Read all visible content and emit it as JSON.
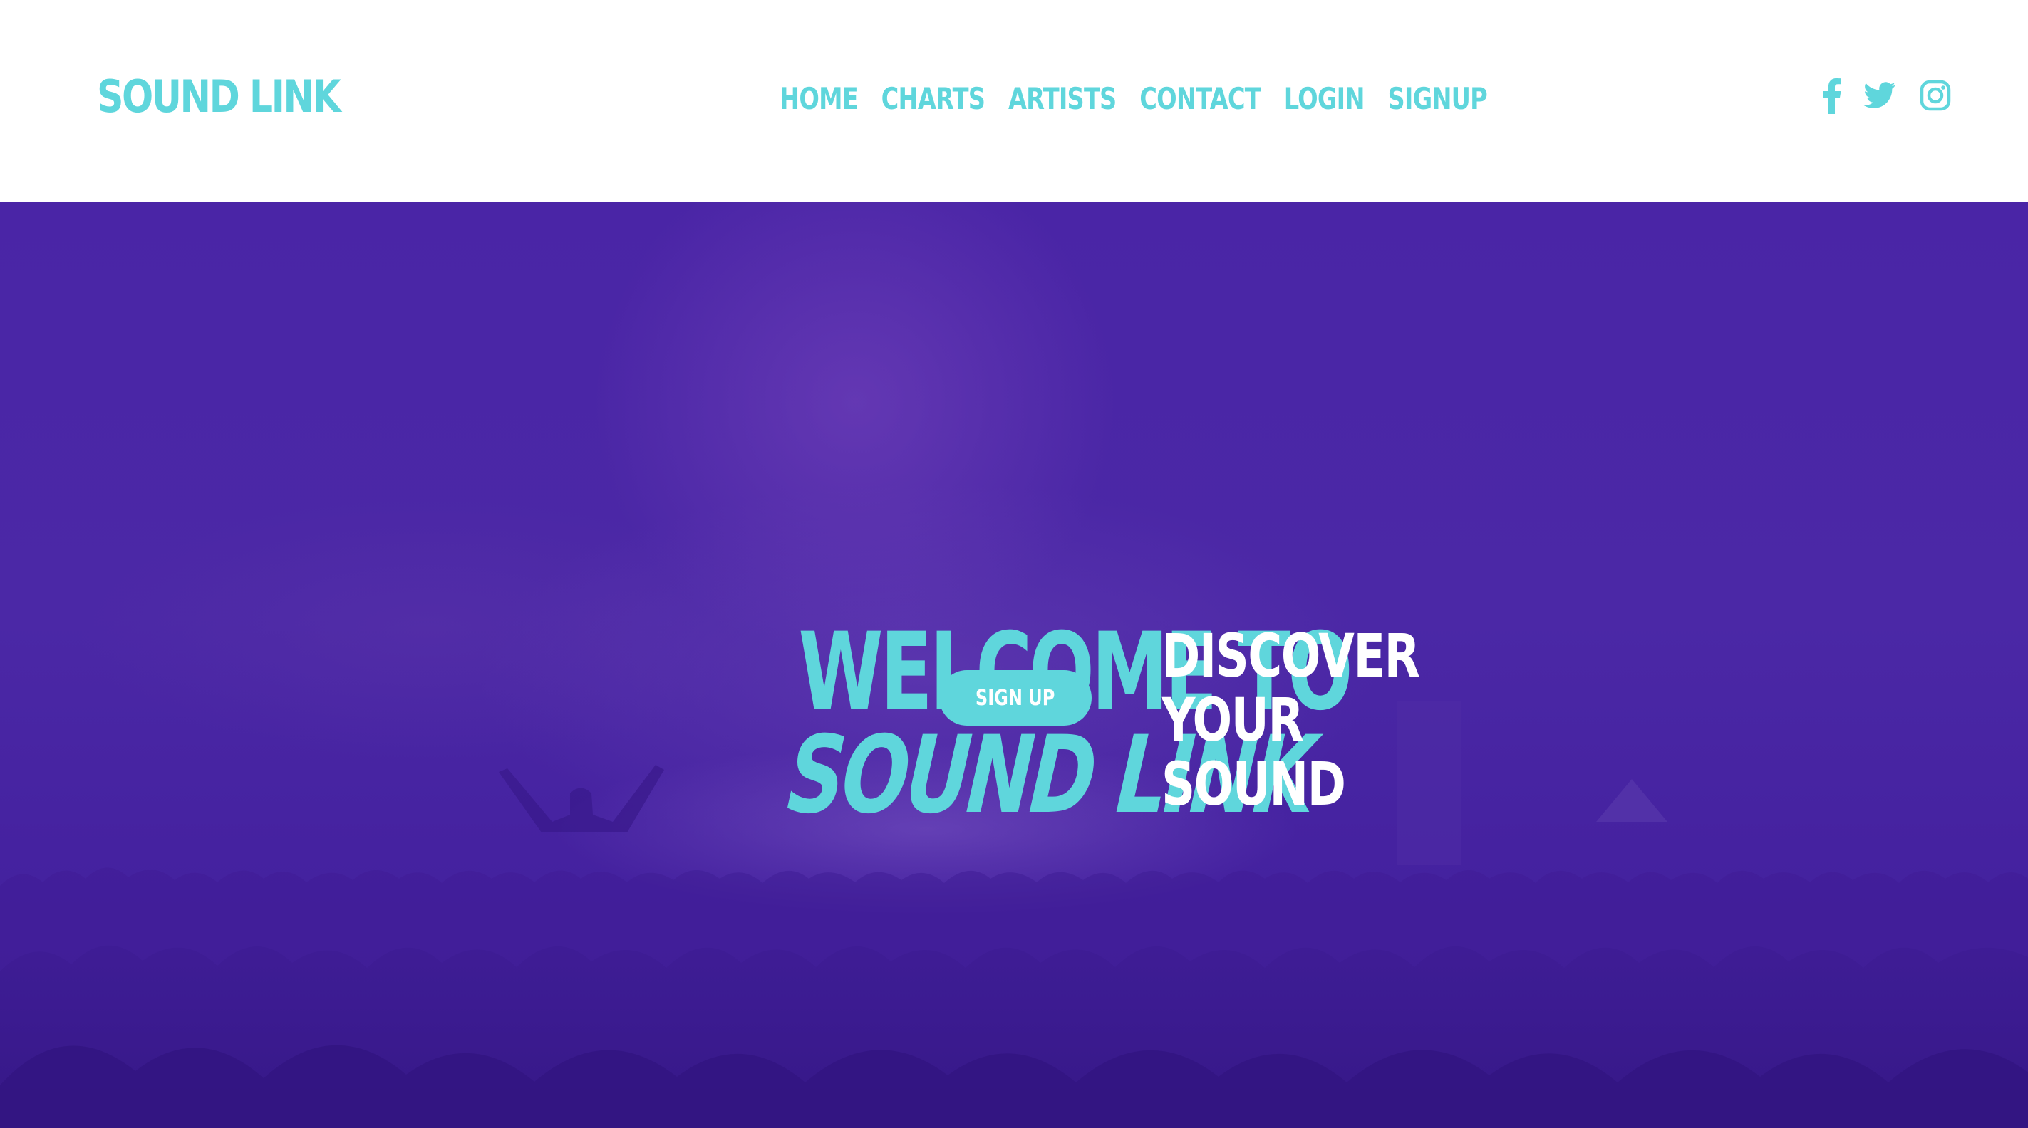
{
  "brand": {
    "logo_text": "SOUND LINK"
  },
  "nav": {
    "items": [
      {
        "label": "HOME"
      },
      {
        "label": "CHARTS"
      },
      {
        "label": "ARTISTS"
      },
      {
        "label": "CONTACT"
      },
      {
        "label": "LOGIN"
      },
      {
        "label": "SIGNUP"
      }
    ]
  },
  "social": {
    "icons": [
      "facebook-icon",
      "twitter-icon",
      "instagram-icon"
    ]
  },
  "hero": {
    "headline_line1": "WELCOME TO",
    "headline_line2": "SOUND LINK",
    "tagline": [
      "DISCOVER",
      "YOUR",
      "SOUND"
    ],
    "cta_label": "SIGN UP"
  },
  "colors": {
    "accent": "#5fd6dc",
    "hero_background": "#4722a0",
    "header_background": "#ffffff",
    "tagline_text": "#ffffff"
  }
}
